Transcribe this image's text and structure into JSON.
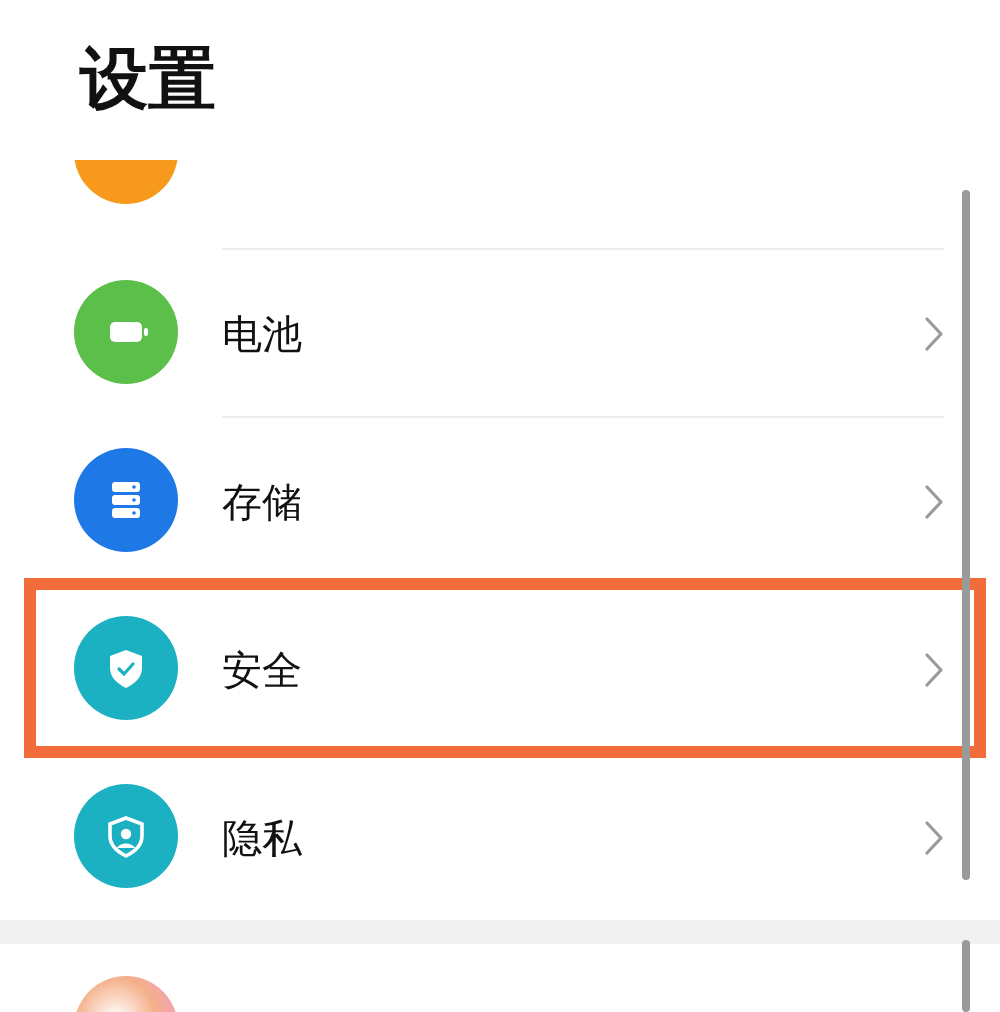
{
  "title": "设置",
  "groups": [
    {
      "items": [
        {
          "kind": "partial",
          "color": "#f7991c"
        },
        {
          "kind": "row",
          "label": "电池",
          "color": "#5cbf4a",
          "highlighted": false
        },
        {
          "kind": "row",
          "label": "存储",
          "color": "#1e78e6",
          "highlighted": false
        },
        {
          "kind": "row",
          "label": "安全",
          "color": "#1cb1c2",
          "highlighted": true
        },
        {
          "kind": "row",
          "label": "隐私",
          "color": "#1cb1c2",
          "highlighted": false
        }
      ]
    },
    {
      "items": [
        {
          "kind": "partial-bottom",
          "color": "#f4b08a"
        }
      ]
    }
  ]
}
